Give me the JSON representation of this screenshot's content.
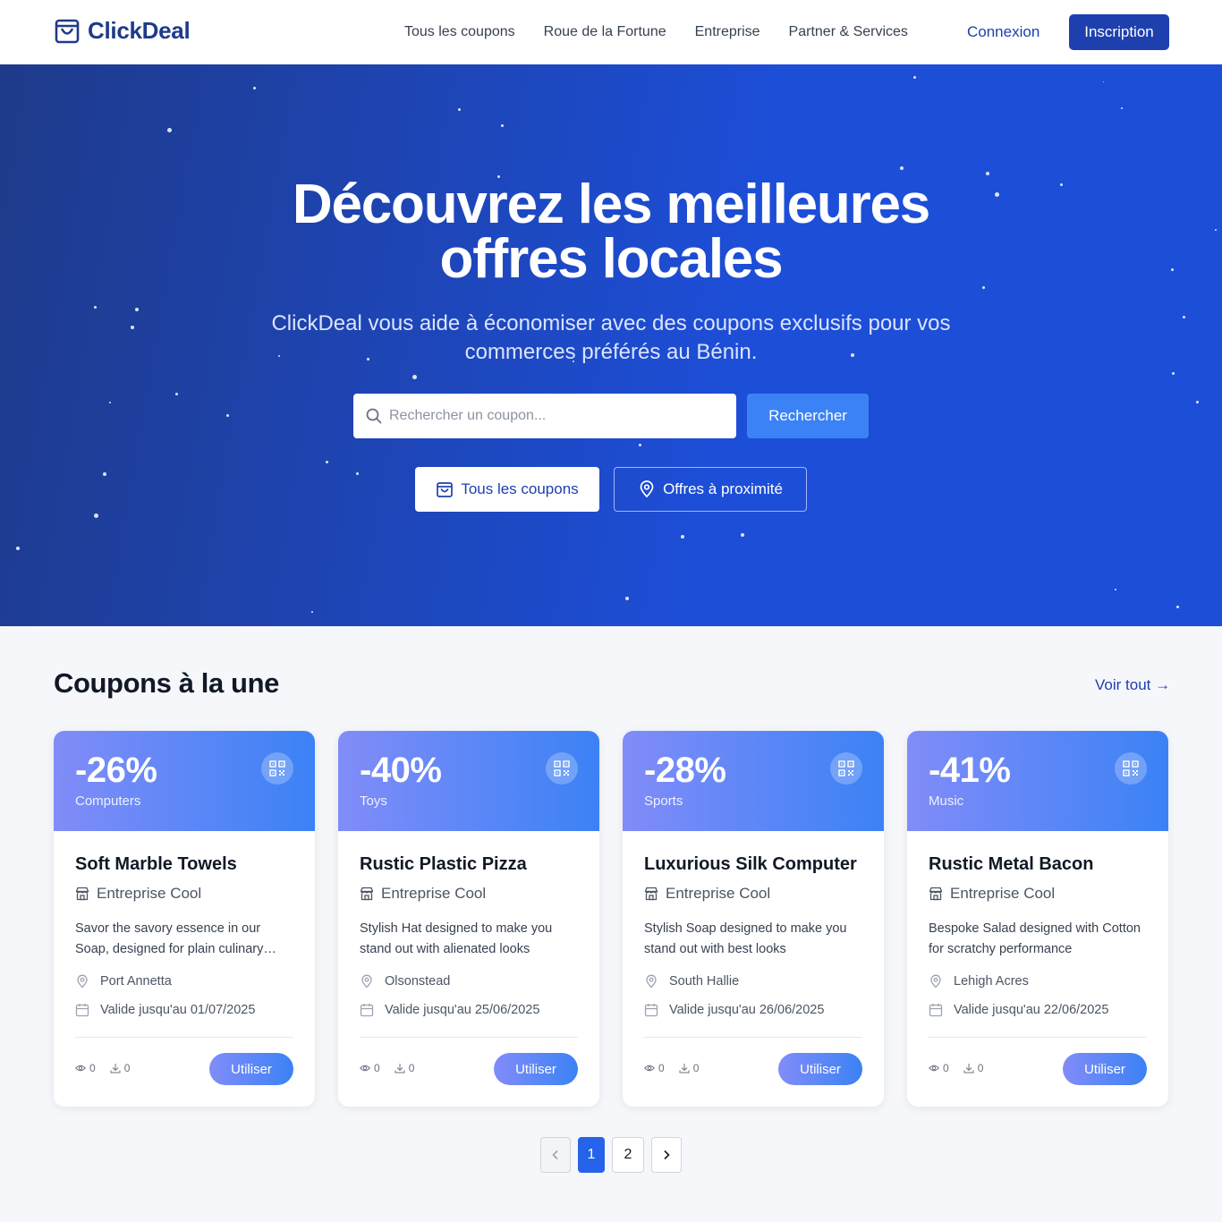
{
  "brand": {
    "name": "ClickDeal",
    "color": "#1e3a8a"
  },
  "nav": {
    "links": [
      "Tous les coupons",
      "Roue de la Fortune",
      "Entreprise",
      "Partner & Services"
    ],
    "login": "Connexion",
    "signup": "Inscription"
  },
  "hero": {
    "title_line1": "Découvrez les meilleures",
    "title_line2": "offres locales",
    "subtitle": "ClickDeal vous aide à économiser avec des coupons exclusifs pour vos commerces préférés au Bénin.",
    "search_placeholder": "Rechercher un coupon...",
    "search_button": "Rechercher",
    "btn_all": "Tous les coupons",
    "btn_nearby": "Offres à proximité"
  },
  "featured": {
    "title": "Coupons à la une",
    "see_all": "Voir tout →",
    "use_label": "Utiliser",
    "cards": [
      {
        "discount": "-26%",
        "category": "Computers",
        "title": "Soft Marble Towels",
        "vendor": "Entreprise Cool",
        "description": "Savor the savory essence in our Soap, designed for plain culinary adventures",
        "location": "Port Annetta",
        "valid": "Valide jusqu'au 01/07/2025",
        "views": "0",
        "downloads": "0"
      },
      {
        "discount": "-40%",
        "category": "Toys",
        "title": "Rustic Plastic Pizza",
        "vendor": "Entreprise Cool",
        "description": "Stylish Hat designed to make you stand out with alienated looks",
        "location": "Olsonstead",
        "valid": "Valide jusqu'au 25/06/2025",
        "views": "0",
        "downloads": "0"
      },
      {
        "discount": "-28%",
        "category": "Sports",
        "title": "Luxurious Silk Computer",
        "vendor": "Entreprise Cool",
        "description": "Stylish Soap designed to make you stand out with best looks",
        "location": "South Hallie",
        "valid": "Valide jusqu'au 26/06/2025",
        "views": "0",
        "downloads": "0"
      },
      {
        "discount": "-41%",
        "category": "Music",
        "title": "Rustic Metal Bacon",
        "vendor": "Entreprise Cool",
        "description": "Bespoke Salad designed with Cotton for scratchy performance",
        "location": "Lehigh Acres",
        "valid": "Valide jusqu'au 22/06/2025",
        "views": "0",
        "downloads": "0"
      }
    ]
  },
  "pagination": {
    "pages": [
      "1",
      "2"
    ],
    "current": "1"
  },
  "colors": {
    "primary": "#1e40af",
    "accent": "#3b82f6",
    "card_gradient_start": "#818cf8",
    "card_gradient_end": "#3b82f6"
  }
}
